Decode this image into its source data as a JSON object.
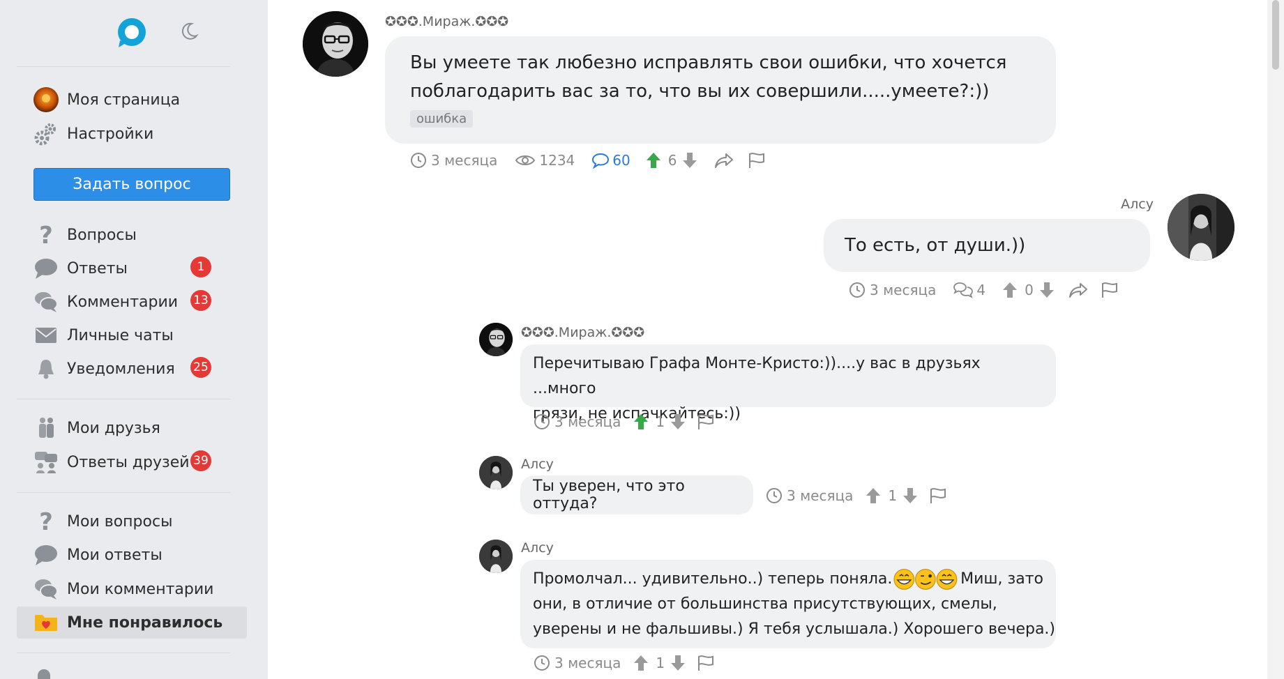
{
  "sidebar": {
    "items": [
      {
        "label": "Моя страница",
        "icon": "avatar-icon"
      },
      {
        "label": "Настройки",
        "icon": "gears-icon"
      },
      {
        "label": "Вопросы",
        "icon": "question-icon"
      },
      {
        "label": "Ответы",
        "icon": "chat-bubble-icon",
        "badge": "1"
      },
      {
        "label": "Комментарии",
        "icon": "comments-icon",
        "badge": "13"
      },
      {
        "label": "Личные чаты",
        "icon": "envelope-icon"
      },
      {
        "label": "Уведомления",
        "icon": "bell-icon",
        "badge": "25"
      },
      {
        "label": "Мои друзья",
        "icon": "friends-icon"
      },
      {
        "label": "Ответы друзей",
        "icon": "friends-answers-icon",
        "badge": "39"
      },
      {
        "label": "Мои вопросы",
        "icon": "question-icon"
      },
      {
        "label": "Мои ответы",
        "icon": "chat-bubble-icon"
      },
      {
        "label": "Мои комментарии",
        "icon": "comments-icon"
      },
      {
        "label": "Мне понравилось",
        "icon": "heart-folder-icon",
        "active": true
      }
    ],
    "ask_button": "Задать вопрос"
  },
  "question": {
    "author": "✪✪✪.Мираж.✪✪✪",
    "text_line1": "Вы умеете так любезно исправлять свои ошибки, что хочется",
    "text_line2": "поблагодарить вас за то, что вы их совершили.....умеете?:))",
    "tag": "ошибка",
    "time": "3 месяца",
    "views": "1234",
    "answers": "60",
    "votes": "6"
  },
  "answer": {
    "author": "Алсу",
    "text": "То есть, от души.))",
    "time": "3 месяца",
    "comments": "4",
    "votes": "0"
  },
  "comments": [
    {
      "author": "✪✪✪.Мираж.✪✪✪",
      "line1": "Перечитываю Графа Монте-Кристо:))....у вас в друзьях ...много",
      "line2": "грязи, не испачкайтесь:))",
      "time": "3 месяца",
      "votes": "1"
    },
    {
      "author": "Алсу",
      "line1": "Ты уверен, что это оттуда?",
      "time": "3 месяца",
      "votes": "1"
    },
    {
      "author": "Алсу",
      "line1": "Промолчал... удивительно..) теперь поняла.",
      "line1_end": "Миш, зато",
      "line2": "они, в отличие от большинства присутствующих, смелы,",
      "line3": "уверены и не фальшивы.) Я тебя услышала.) Хорошего вечера.)",
      "time": "3 месяца",
      "votes": "1"
    }
  ],
  "colors": {
    "accent": "#2d8ee8",
    "badge": "#e53935",
    "upvote": "#3aa84a",
    "link": "#2a7bd1",
    "sidebar_bg": "#e9ebee",
    "bubble_bg": "#f0f1f3"
  }
}
